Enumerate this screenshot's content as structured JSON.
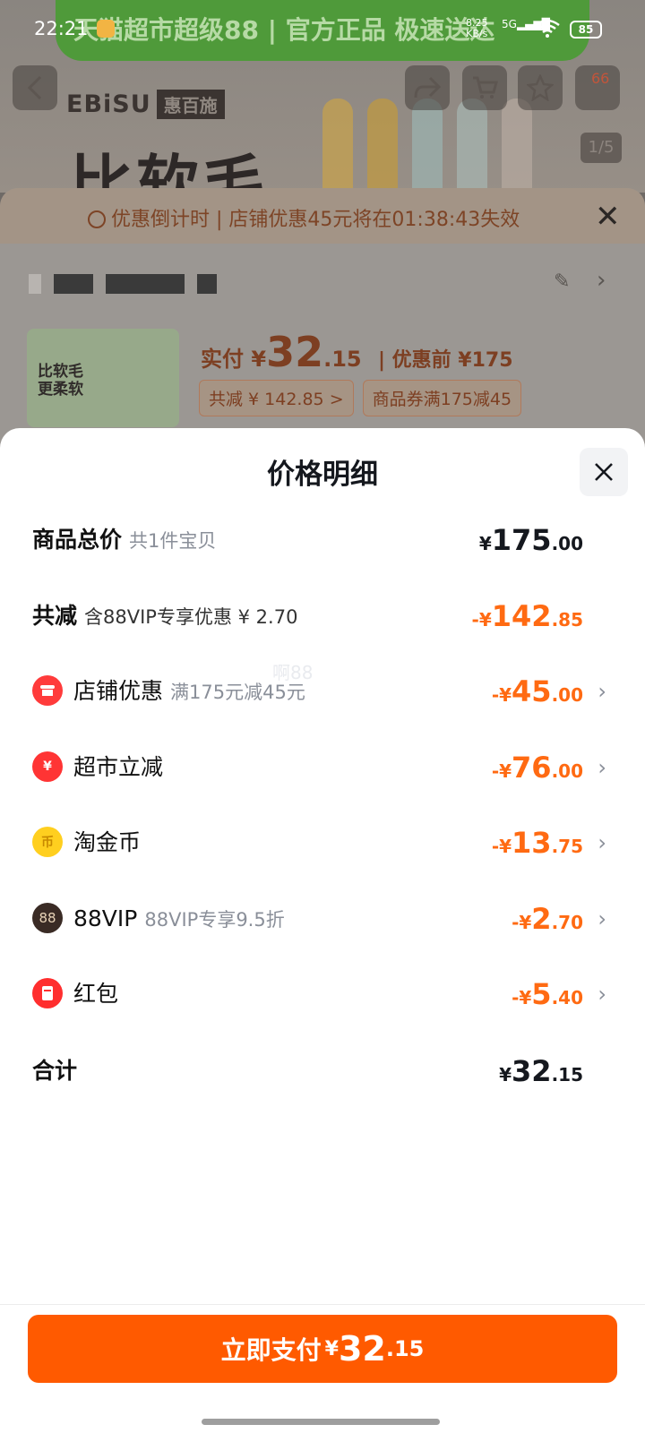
{
  "status_bar": {
    "time": "22:21",
    "net_speed": "8.25",
    "net_unit": "KB/s",
    "network": "5G",
    "battery": "85"
  },
  "background": {
    "banner_text": "天猫超市超级88 | 官方正品 极速送达",
    "brand": "EBiSU",
    "brand_cn": "惠百施",
    "headline": "比软毛",
    "cart_badge": "66",
    "pager": "1/5",
    "countdown_label": "优惠倒计时",
    "countdown_text": "店铺优惠45元将在01:38:43失效",
    "thumb_text": "比软毛\n更柔软",
    "paid_label": "实付 ¥",
    "paid_int": "32",
    "paid_dec": ".15",
    "before_label": "| 优惠前 ¥175",
    "tag_total_off": "共减 ¥ 142.85 >",
    "tag_coupon": "商品券满175减45"
  },
  "modal": {
    "title": "价格明细",
    "rows": [
      {
        "label": "商品总价",
        "sub": "共1件宝贝",
        "cur": "¥",
        "int": "175",
        "dec": ".00"
      },
      {
        "label": "共减",
        "sub": "含88VIP专享优惠 ¥ 2.70",
        "cur": "-¥",
        "int": "142",
        "dec": ".85"
      },
      {
        "label": "店铺优惠",
        "sub": "满175元减45元",
        "cur": "-¥",
        "int": "45",
        "dec": ".00",
        "icon": "shop-icon"
      },
      {
        "label": "超市立减",
        "sub": "",
        "cur": "-¥",
        "int": "76",
        "dec": ".00",
        "icon": "yuan-discount-icon"
      },
      {
        "label": "淘金币",
        "sub": "",
        "cur": "-¥",
        "int": "13",
        "dec": ".75",
        "icon": "gold-coin-icon"
      },
      {
        "label": "88VIP",
        "sub": "88VIP专享9.5折",
        "cur": "-¥",
        "int": "2",
        "dec": ".70",
        "icon": "vip88-icon",
        "icon_text": "88"
      },
      {
        "label": "红包",
        "sub": "",
        "cur": "-¥",
        "int": "5",
        "dec": ".40",
        "icon": "red-packet-icon"
      },
      {
        "label": "合计",
        "sub": "",
        "cur": "¥",
        "int": "32",
        "dec": ".15"
      }
    ],
    "watermark": "啊88",
    "pay_button": {
      "label": "立即支付",
      "cur": "¥",
      "int": "32",
      "dec": ".15"
    }
  },
  "colors": {
    "accent": "#ff5a00",
    "discount": "#ff6a12",
    "text": "#15181e",
    "muted": "#8a8f99"
  }
}
